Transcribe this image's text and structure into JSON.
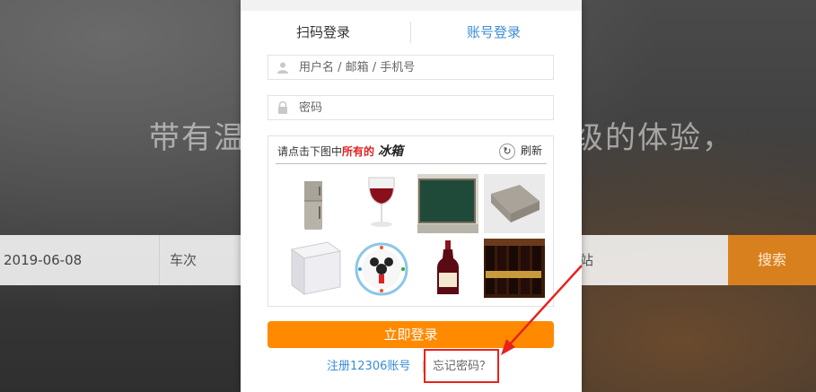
{
  "background": {
    "hero_text_left": "带有温",
    "hero_text_right": "级的体验，",
    "search": {
      "date_value": "2019-06-08",
      "train_label": "车次",
      "station_label": "站",
      "search_button": "搜索"
    }
  },
  "login": {
    "tabs": {
      "qr_label": "扫码登录",
      "account_label": "账号登录"
    },
    "username_placeholder": "用户名 / 邮箱 / 手机号",
    "password_placeholder": "密码",
    "captcha": {
      "prompt": "请点击下图中",
      "prompt_highlight": "所有的",
      "target_word": "冰箱",
      "refresh_label": "刷新",
      "images": [
        {
          "name": "fridge"
        },
        {
          "name": "wine-glass"
        },
        {
          "name": "chalkboard"
        },
        {
          "name": "sponge"
        },
        {
          "name": "white-freezer"
        },
        {
          "name": "mickey-clock"
        },
        {
          "name": "wine-bottle"
        },
        {
          "name": "wine-rack"
        }
      ]
    },
    "login_button": "立即登录",
    "register_link": "注册12306账号",
    "separator": "|",
    "forgot_link": "忘记密码？"
  },
  "colors": {
    "accent_orange": "#ff8a00",
    "link_blue": "#3b8cd6",
    "annotation_red": "#e8221c"
  }
}
